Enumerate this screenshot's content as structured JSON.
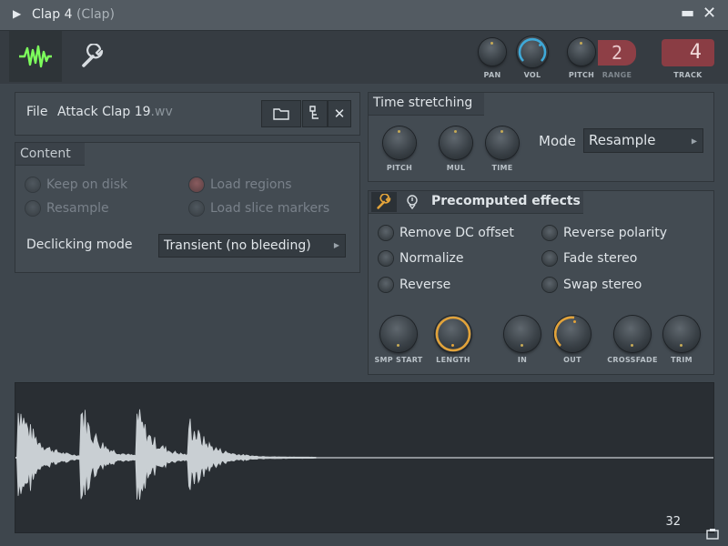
{
  "window": {
    "title": "Clap 4",
    "subtitle": "(Clap)"
  },
  "toolbar": {
    "knobs": [
      {
        "label": "PAN"
      },
      {
        "label": "VOL"
      },
      {
        "label": "PITCH"
      }
    ],
    "range_label": "RANGE",
    "range_value": "2",
    "track_label": "TRACK",
    "track_value": "4"
  },
  "file": {
    "label": "File",
    "name": "Attack Clap 19",
    "extension": ".wv"
  },
  "content": {
    "title": "Content",
    "options": [
      {
        "label": "Keep on disk",
        "enabled": false,
        "checked": false
      },
      {
        "label": "Load regions",
        "enabled": false,
        "checked": true
      },
      {
        "label": "Resample",
        "enabled": false,
        "checked": false
      },
      {
        "label": "Load slice markers",
        "enabled": false,
        "checked": false
      }
    ],
    "declicking_label": "Declicking mode",
    "declicking_value": "Transient (no bleeding)"
  },
  "time_stretching": {
    "title": "Time stretching",
    "knobs": [
      {
        "label": "PITCH"
      },
      {
        "label": "MUL"
      },
      {
        "label": "TIME"
      }
    ],
    "mode_label": "Mode",
    "mode_value": "Resample"
  },
  "effects": {
    "title": "Precomputed effects",
    "options": [
      {
        "label": "Remove DC offset"
      },
      {
        "label": "Reverse polarity"
      },
      {
        "label": "Normalize"
      },
      {
        "label": "Fade stereo"
      },
      {
        "label": "Reverse"
      },
      {
        "label": "Swap stereo"
      }
    ],
    "knobs": [
      {
        "label": "SMP START"
      },
      {
        "label": "LENGTH"
      },
      {
        "label": "IN"
      },
      {
        "label": "OUT"
      },
      {
        "label": "CROSSFADE"
      },
      {
        "label": "TRIM"
      }
    ]
  },
  "waveform": {
    "zoom_value": "32"
  },
  "colors": {
    "accent_blue": "#3fa9d8",
    "accent_orange": "#e2a33a",
    "accent_green": "#7dff5c",
    "track_red": "#8a3d44"
  }
}
